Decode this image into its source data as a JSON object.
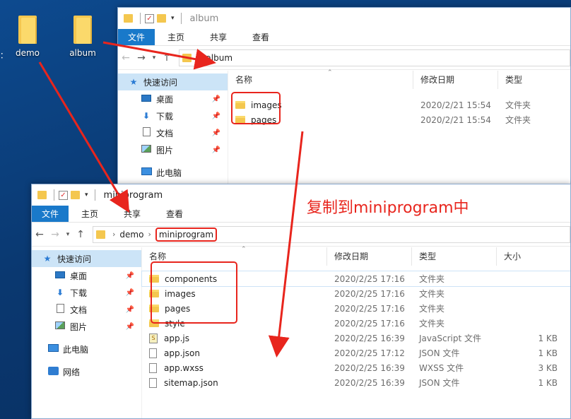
{
  "desktop": {
    "icons": [
      {
        "label": "demo"
      },
      {
        "label": "album"
      }
    ],
    "edge_char": "："
  },
  "album_window": {
    "title": "album",
    "ribbon_tabs": [
      "文件",
      "主页",
      "共享",
      "查看"
    ],
    "path": [
      "album"
    ],
    "columns": {
      "name": "名称",
      "date": "修改日期",
      "type": "类型"
    },
    "nav": {
      "quick_access": "快速访问",
      "items": [
        "桌面",
        "下载",
        "文档",
        "图片"
      ],
      "this_pc_partial": "此电脑"
    },
    "rows": [
      {
        "name": "images",
        "date": "2020/2/21 15:54",
        "type": "文件夹"
      },
      {
        "name": "pages",
        "date": "2020/2/21 15:54",
        "type": "文件夹"
      }
    ]
  },
  "mini_window": {
    "title": "miniprogram",
    "ribbon_tabs": [
      "文件",
      "主页",
      "共享",
      "查看"
    ],
    "path": [
      "demo",
      "miniprogram"
    ],
    "columns": {
      "name": "名称",
      "date": "修改日期",
      "type": "类型",
      "size": "大小"
    },
    "nav": {
      "quick_access": "快速访问",
      "items": [
        "桌面",
        "下载",
        "文档",
        "图片"
      ],
      "this_pc": "此电脑",
      "network": "网络"
    },
    "rows": [
      {
        "name": "components",
        "date": "2020/2/25 17:16",
        "type": "文件夹",
        "size": "",
        "kind": "folder"
      },
      {
        "name": "images",
        "date": "2020/2/25 17:16",
        "type": "文件夹",
        "size": "",
        "kind": "folder"
      },
      {
        "name": "pages",
        "date": "2020/2/25 17:16",
        "type": "文件夹",
        "size": "",
        "kind": "folder"
      },
      {
        "name": "style",
        "date": "2020/2/25 17:16",
        "type": "文件夹",
        "size": "",
        "kind": "folder"
      },
      {
        "name": "app.js",
        "date": "2020/2/25 16:39",
        "type": "JavaScript 文件",
        "size": "1 KB",
        "kind": "js"
      },
      {
        "name": "app.json",
        "date": "2020/2/25 17:12",
        "type": "JSON 文件",
        "size": "1 KB",
        "kind": "file"
      },
      {
        "name": "app.wxss",
        "date": "2020/2/25 16:39",
        "type": "WXSS 文件",
        "size": "3 KB",
        "kind": "file"
      },
      {
        "name": "sitemap.json",
        "date": "2020/2/25 16:39",
        "type": "JSON 文件",
        "size": "1 KB",
        "kind": "file"
      }
    ]
  },
  "annotation": {
    "text": "复制到miniprogram中",
    "color": "#e8251d"
  },
  "colors": {
    "accent": "#1979ca",
    "selection": "#cce4f7",
    "annotation_red": "#e8251d"
  }
}
